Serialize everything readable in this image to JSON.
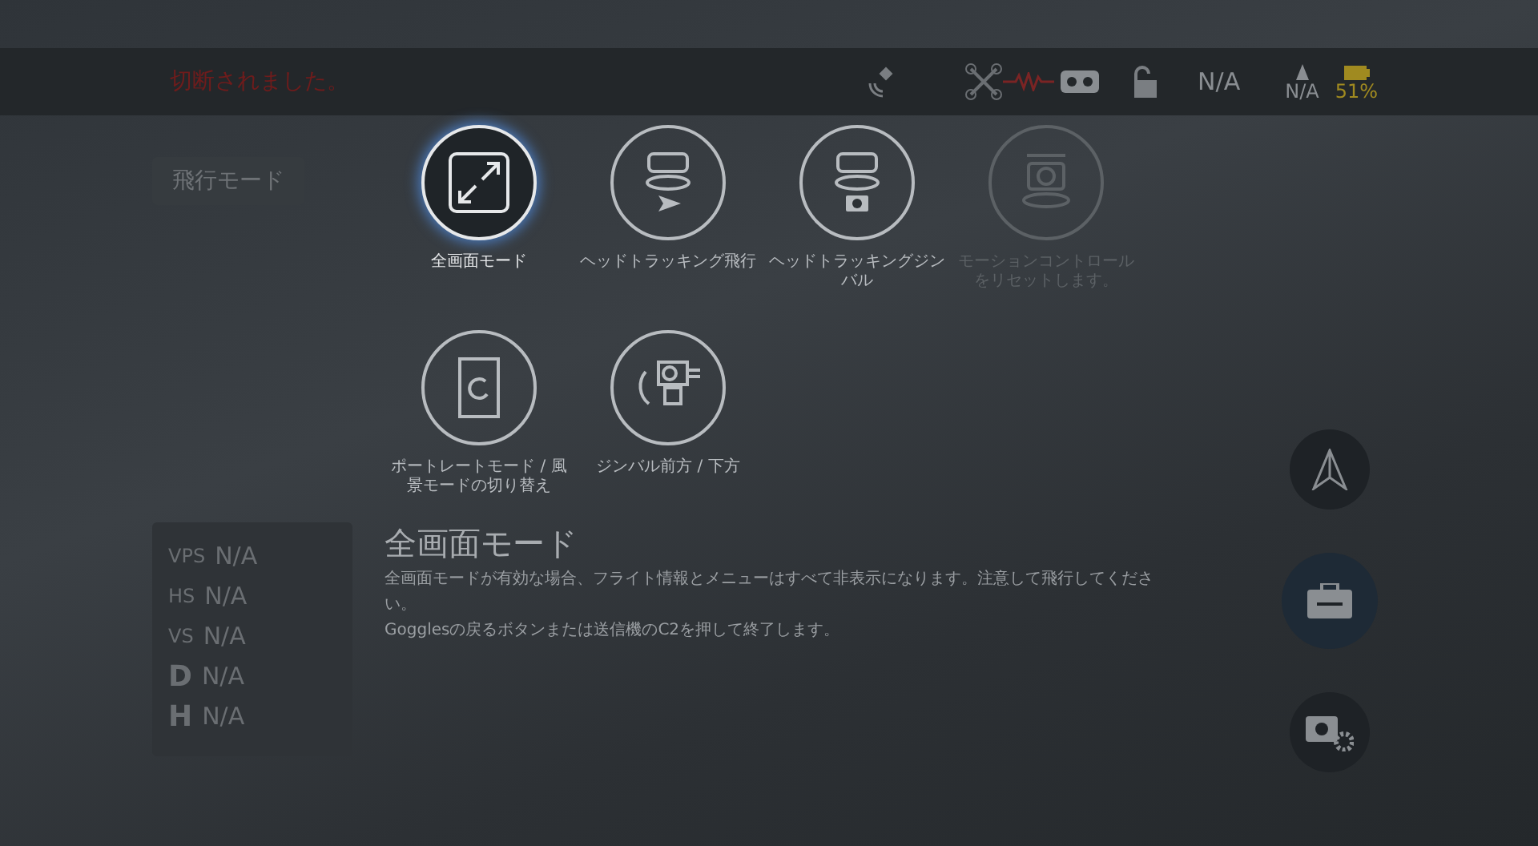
{
  "status_bar": {
    "message": "切断されました。",
    "signal_text": "N/A",
    "altitude": "N/A",
    "battery": "51%"
  },
  "flight_mode": "飛行モード",
  "modes": [
    {
      "kind": "fullscreen",
      "label": "全画面モード",
      "selected": true,
      "disabled": false
    },
    {
      "kind": "head-flight",
      "label": "ヘッドトラッキング飛行",
      "selected": false,
      "disabled": false
    },
    {
      "kind": "head-gimbal",
      "label": "ヘッドトラッキングジンバル",
      "selected": false,
      "disabled": false
    },
    {
      "kind": "motion-reset",
      "label": "モーションコントロールをリセットします。",
      "selected": false,
      "disabled": true
    },
    {
      "kind": "rotate",
      "label": "ポートレートモード / 風景モードの切り替え",
      "selected": false,
      "disabled": false
    },
    {
      "kind": "gimbal",
      "label": "ジンバル前方 / 下方",
      "selected": false,
      "disabled": false
    }
  ],
  "telemetry": [
    {
      "label": "VPS",
      "value": "N/A"
    },
    {
      "label": "HS",
      "value": "N/A"
    },
    {
      "label": "VS",
      "value": "N/A"
    },
    {
      "label": "D",
      "value": "N/A"
    },
    {
      "label": "H",
      "value": "N/A"
    }
  ],
  "description": {
    "title": "全画面モード",
    "lines": [
      "全画面モードが有効な場合、フライト情報とメニューはすべて非表示になります。注意して飛行してください。",
      "Gogglesの戻るボタンまたは送信機のC2を押して終了します。"
    ]
  },
  "side_buttons": [
    {
      "kind": "flight",
      "selected": false
    },
    {
      "kind": "toolbox",
      "selected": true
    },
    {
      "kind": "camera-settings",
      "selected": false
    }
  ]
}
